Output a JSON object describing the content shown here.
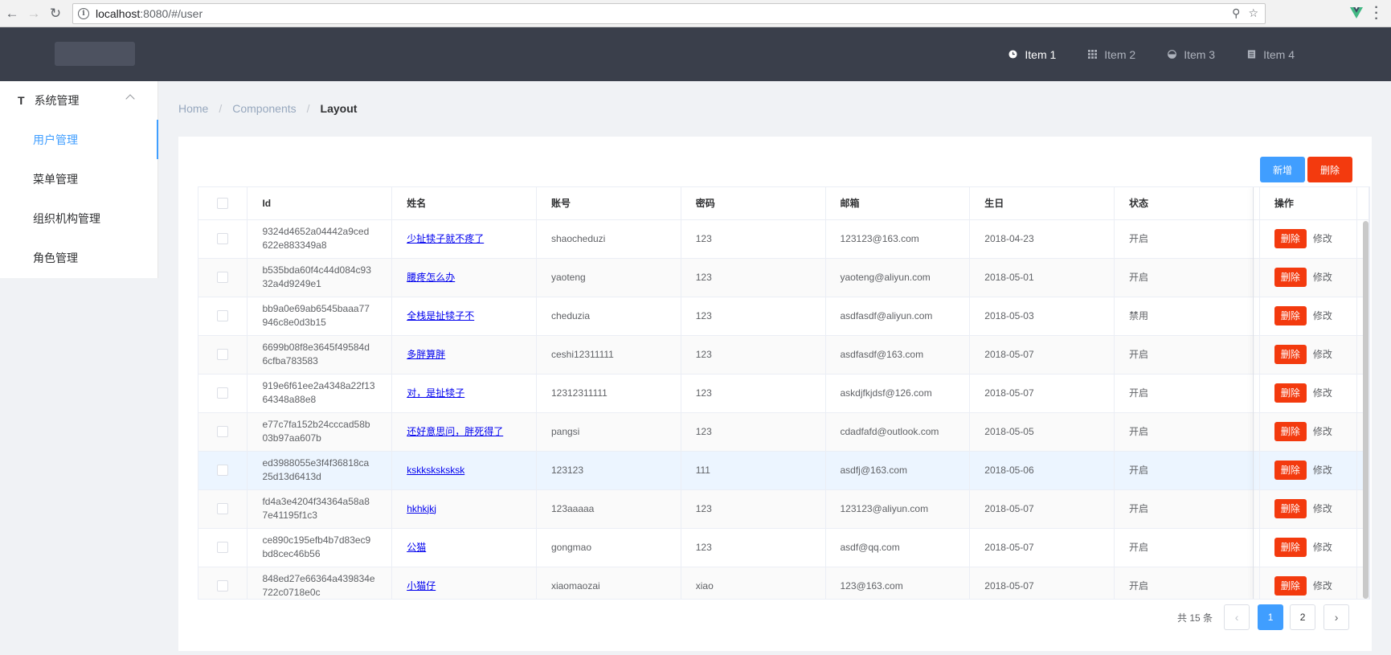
{
  "browser": {
    "url_host": "localhost",
    "url_path": ":8080/#/user"
  },
  "header": {
    "menu": [
      {
        "label": "Item 1",
        "icon": "clock-icon",
        "active": true
      },
      {
        "label": "Item 2",
        "icon": "grid-icon",
        "active": false
      },
      {
        "label": "Item 3",
        "icon": "pie-icon",
        "active": false
      },
      {
        "label": "Item 4",
        "icon": "document-icon",
        "active": false
      }
    ]
  },
  "sidebar": {
    "group_icon": "T",
    "group_label": "系统管理",
    "items": [
      {
        "label": "用户管理"
      },
      {
        "label": "菜单管理"
      },
      {
        "label": "组织机构管理"
      },
      {
        "label": "角色管理"
      }
    ]
  },
  "breadcrumb": {
    "items": [
      "Home",
      "Components",
      "Layout"
    ],
    "separator": "/"
  },
  "toolbar": {
    "add_label": "新增",
    "delete_label": "删除"
  },
  "table": {
    "columns": [
      "Id",
      "姓名",
      "账号",
      "密码",
      "邮箱",
      "生日",
      "状态",
      "操作"
    ],
    "row_delete_label": "删除",
    "row_edit_label": "修改",
    "rows": [
      {
        "id1": "9324d4652a04442a9ced",
        "id2": "622e883349a8",
        "name": "少扯犊子就不疼了",
        "account": "shaocheduzi",
        "password": "123",
        "email": "123123@163.com",
        "birthday": "2018-04-23",
        "status": "开启"
      },
      {
        "id1": "b535bda60f4c44d084c93",
        "id2": "32a4d9249e1",
        "name": "腰疼怎么办",
        "account": "yaoteng",
        "password": "123",
        "email": "yaoteng@aliyun.com",
        "birthday": "2018-05-01",
        "status": "开启"
      },
      {
        "id1": "bb9a0e69ab6545baaa77",
        "id2": "946c8e0d3b15",
        "name": "全栈是扯犊子不",
        "account": "cheduzia",
        "password": "123",
        "email": "asdfasdf@aliyun.com",
        "birthday": "2018-05-03",
        "status": "禁用"
      },
      {
        "id1": "6699b08f8e3645f49584d",
        "id2": "6cfba783583",
        "name": "多胖算胖",
        "account": "ceshi12311111",
        "password": "123",
        "email": "asdfasdf@163.com",
        "birthday": "2018-05-07",
        "status": "开启"
      },
      {
        "id1": "919e6f61ee2a4348a22f13",
        "id2": "64348a88e8",
        "name": "对，是扯犊子",
        "account": "12312311111",
        "password": "123",
        "email": "askdjfkjdsf@126.com",
        "birthday": "2018-05-07",
        "status": "开启"
      },
      {
        "id1": "e77c7fa152b24cccad58b",
        "id2": "03b97aa607b",
        "name": "还好意思问，胖死得了",
        "account": "pangsi",
        "password": "123",
        "email": "cdadfafd@outlook.com",
        "birthday": "2018-05-05",
        "status": "开启"
      },
      {
        "id1": "ed3988055e3f4f36818ca",
        "id2": "25d13d6413d",
        "name": "kskksksksksk",
        "account": "123123",
        "password": "111",
        "email": "asdfj@163.com",
        "birthday": "2018-05-06",
        "status": "开启"
      },
      {
        "id1": "fd4a3e4204f34364a58a8",
        "id2": "7e41195f1c3",
        "name": "hkhkjkj",
        "account": "123aaaaa",
        "password": "123",
        "email": "123123@aliyun.com",
        "birthday": "2018-05-07",
        "status": "开启"
      },
      {
        "id1": "ce890c195efb4b7d83ec9",
        "id2": "bd8cec46b56",
        "name": "公猫",
        "account": "gongmao",
        "password": "123",
        "email": "asdf@qq.com",
        "birthday": "2018-05-07",
        "status": "开启"
      },
      {
        "id1": "848ed27e66364a439834e",
        "id2": "722c0718e0c",
        "name": "小猫仔",
        "account": "xiaomaozai",
        "password": "xiao",
        "email": "123@163.com",
        "birthday": "2018-05-07",
        "status": "开启"
      }
    ]
  },
  "pagination": {
    "total_label": "共 15 条",
    "pages": [
      "1",
      "2"
    ],
    "current": "1"
  },
  "colors": {
    "header_bg": "#3a3f4b",
    "primary": "#409eff",
    "danger": "#f33a0e"
  }
}
